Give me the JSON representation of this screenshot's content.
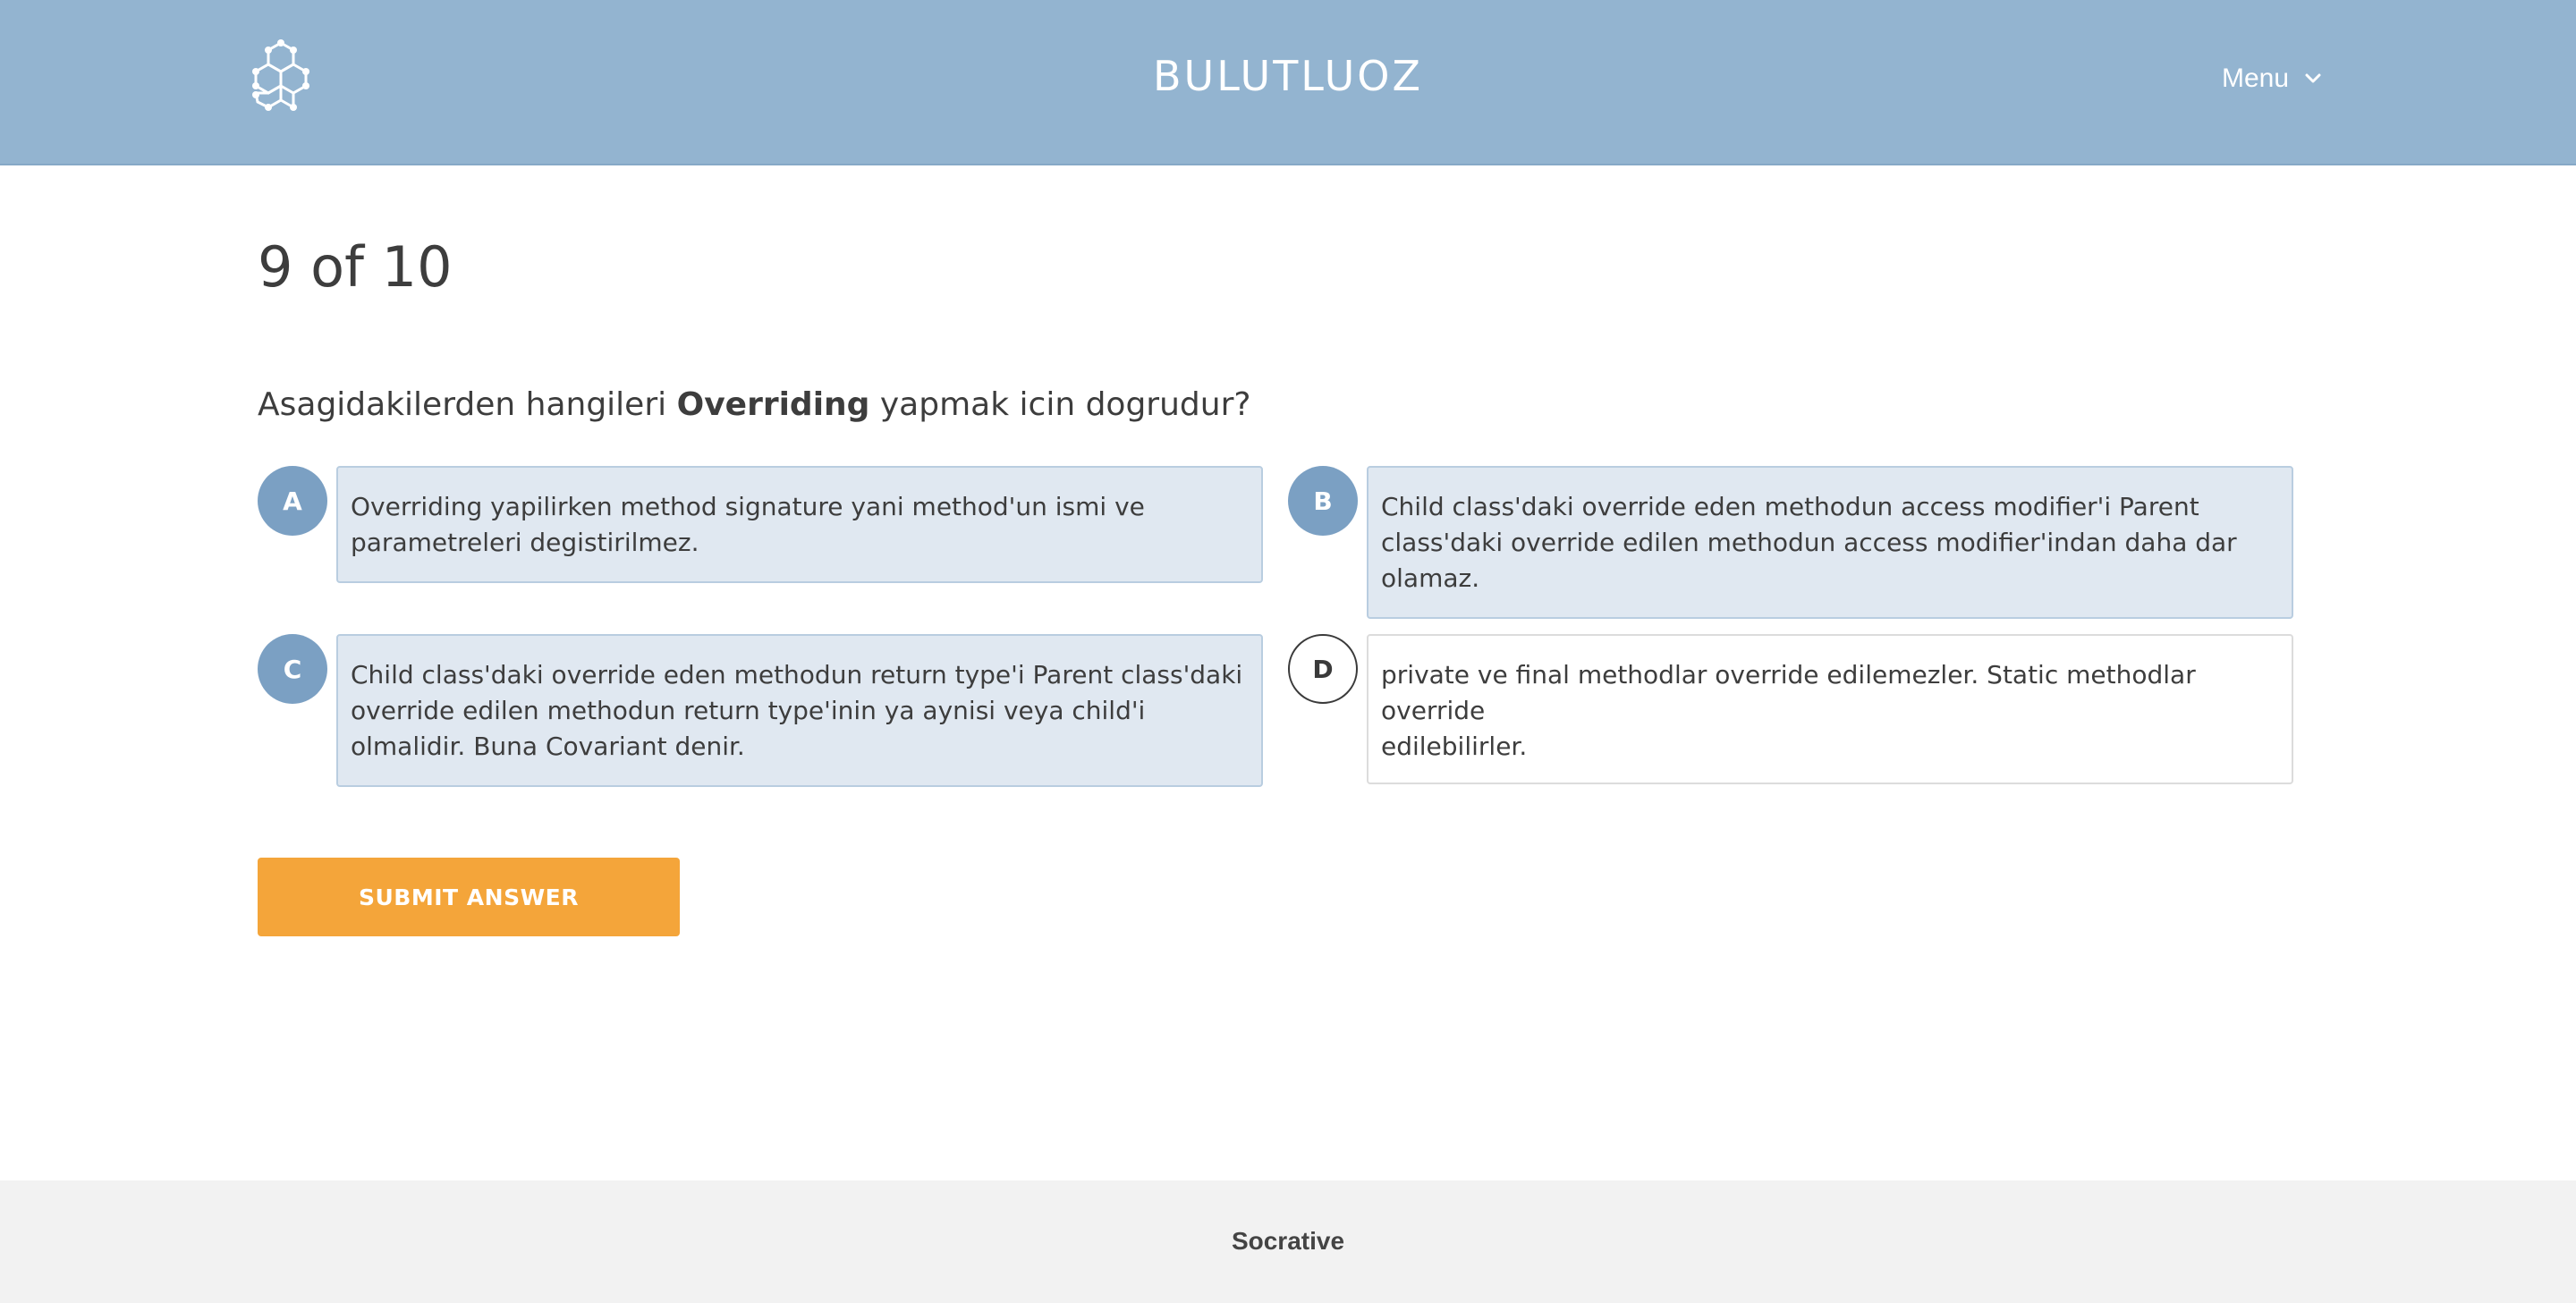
{
  "header": {
    "room_name": "BULUTLUOZ",
    "menu_label": "Menu",
    "logo_icon": "molecule-logo-icon",
    "menu_icon": "chevron-down-icon"
  },
  "quiz": {
    "progress": "9 of 10",
    "question_prefix": "Asagidakilerden hangileri ",
    "question_bold": "Overriding",
    "question_suffix": " yapmak icin dogrudur?",
    "choices": [
      {
        "letter": "A",
        "text": "Overriding yapilirken method signature yani method'un ismi ve\nparametreleri degistirilmez.",
        "selected": true
      },
      {
        "letter": "B",
        "text": "Child class'daki override eden methodun access modifier'i Parent\nclass'daki override edilen methodun access modifier'indan daha dar\nolamaz.",
        "selected": true
      },
      {
        "letter": "C",
        "text": "Child class'daki override eden methodun return type'i Parent class'daki\n override edilen methodun return type'inin ya aynisi veya child'i\nolmalidir. Buna Covariant denir.",
        "selected": true
      },
      {
        "letter": "D",
        "text": "private ve final methodlar override edilemezler. Static methodlar override\nedilebilirler.",
        "selected": false
      }
    ],
    "submit_label": "SUBMIT ANSWER"
  },
  "footer": {
    "brand": "Socrative"
  },
  "colors": {
    "header_bg": "#93b4d0",
    "selected_circle": "#7ba0c3",
    "selected_box": "#e0e8f1",
    "submit_bg": "#f4a53a",
    "footer_bg": "#f2f2f2"
  }
}
